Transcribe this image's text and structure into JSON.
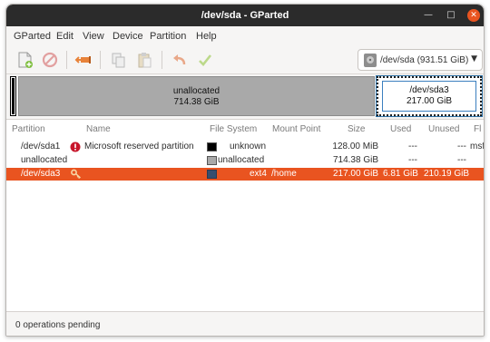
{
  "window": {
    "title": "/dev/sda - GParted"
  },
  "menu": [
    "GParted",
    "Edit",
    "View",
    "Device",
    "Partition",
    "Help"
  ],
  "device_selector": {
    "label": "/dev/sda  (931.51 GiB)"
  },
  "disk_map": {
    "unallocated": {
      "name": "unallocated",
      "size": "714.38 GiB"
    },
    "sda3": {
      "name": "/dev/sda3",
      "size": "217.00 GiB"
    }
  },
  "table": {
    "headers": [
      "Partition",
      "Name",
      "File System",
      "Mount Point",
      "Size",
      "Used",
      "Unused",
      "Fl"
    ],
    "rows": [
      {
        "partition": "/dev/sda1",
        "name": "Microsoft reserved partition",
        "fs": "unknown",
        "fs_color": "#000000",
        "mount": "",
        "size": "128.00 MiB",
        "used": "---",
        "unused": "---",
        "flags": "msf",
        "icon": "error-icon"
      },
      {
        "partition": "unallocated",
        "name": "",
        "fs": "unallocated",
        "fs_color": "#a9a9a9",
        "mount": "",
        "size": "714.38 GiB",
        "used": "---",
        "unused": "---",
        "flags": "",
        "icon": ""
      },
      {
        "partition": "/dev/sda3",
        "name": "",
        "fs": "ext4",
        "fs_color": "#364e6f",
        "mount": "/home",
        "size": "217.00 GiB",
        "used": "6.81 GiB",
        "unused": "210.19 GiB",
        "flags": "",
        "icon": "key-icon",
        "selected": true
      }
    ]
  },
  "status": {
    "text": "0 operations pending"
  },
  "colors": {
    "accent": "#e95420",
    "titlebar": "#2b2b2b",
    "unallocated": "#a9a9a9",
    "ext4": "#364e6f"
  }
}
